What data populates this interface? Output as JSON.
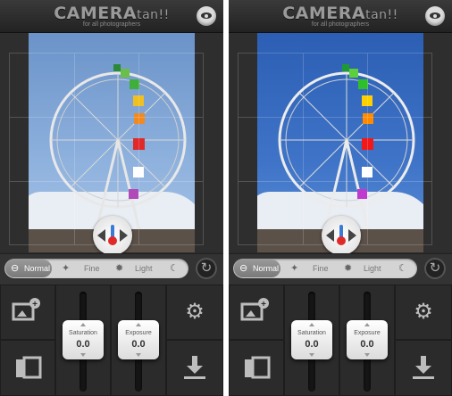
{
  "app": {
    "logo_main": "CAMERA",
    "logo_sub": "tan!!",
    "tagline": "for all photographers"
  },
  "panels": [
    {
      "filters": [
        {
          "label": "Normal",
          "icon": "minus-icon",
          "active": true
        },
        {
          "label": "Fine",
          "icon": "sparkle-icon",
          "active": false
        },
        {
          "label": "Light",
          "icon": "sun-icon",
          "active": false
        },
        {
          "label": "",
          "icon": "moon-icon",
          "active": false
        }
      ],
      "saturation": {
        "label": "Saturation",
        "value": "0.0"
      },
      "exposure": {
        "label": "Exposure",
        "value": "0.0"
      }
    },
    {
      "filters": [
        {
          "label": "Normal",
          "icon": "minus-icon",
          "active": true
        },
        {
          "label": "Fine",
          "icon": "sparkle-icon",
          "active": false
        },
        {
          "label": "Light",
          "icon": "sun-icon",
          "active": false
        },
        {
          "label": "",
          "icon": "moon-icon",
          "active": false
        }
      ],
      "saturation": {
        "label": "Saturation",
        "value": "0.0"
      },
      "exposure": {
        "label": "Exposure",
        "value": "0.0"
      }
    }
  ]
}
